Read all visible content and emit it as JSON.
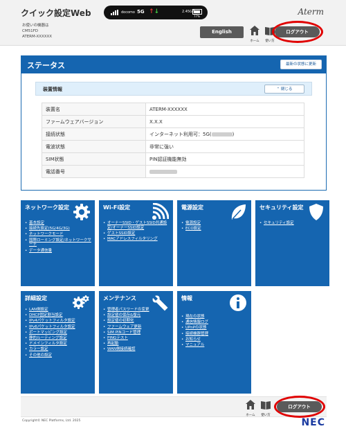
{
  "header": {
    "app_title": "クイック設定Web",
    "device_info": {
      "label": "お使いの機器は",
      "model": "CM51FD",
      "name": "ATERM-XXXXXX"
    },
    "statusbar": {
      "carrier": "docomo",
      "network": "5G",
      "data_used": "2.45GB",
      "battery": "77%"
    },
    "brand": "Aterm",
    "english_label": "English",
    "home_label": "ホーム",
    "usage_label": "使い方",
    "logout_label": "ログアウト"
  },
  "status": {
    "title": "ステータス",
    "refresh_label": "最新の状態に更新",
    "section_label": "装置情報",
    "close_label": "閉じる",
    "rows": [
      {
        "key": "装置名",
        "value": "ATERM-XXXXXX"
      },
      {
        "key": "ファームウェアバージョン",
        "value": "X.X.X"
      },
      {
        "key": "接続状態",
        "value": "インターネット利用可：5G(",
        "value_suffix": ")"
      },
      {
        "key": "電波状態",
        "value": "非常に強い"
      },
      {
        "key": "SIM状態",
        "value": "PIN認証機能無効"
      },
      {
        "key": "電話番号",
        "value": ""
      }
    ]
  },
  "tiles": [
    {
      "title": "ネットワーク設定",
      "icon": "gear-icon",
      "links": [
        "基本設定",
        "接続先設定(5G/4G/3G)",
        "ネットワークモード",
        "国際ローミング設定/ネットワークサーチ",
        "データ通信量"
      ]
    },
    {
      "title": "Wi-Fi設定",
      "icon": "wifi-icon",
      "links": [
        "オーナーSSID・ゲストSSID共通設定/オーナーSSID設定",
        "ゲストSSID設定",
        "MACアドレスフィルタリング"
      ]
    },
    {
      "title": "電源設定",
      "icon": "leaf-icon",
      "links": [
        "電源設定",
        "ECO設定"
      ]
    },
    {
      "title": "セキュリティ設定",
      "icon": "shield-icon",
      "links": [
        "セキュリティ設定"
      ]
    },
    {
      "title": "詳細設定",
      "icon": "gears-icon",
      "links": [
        "LAN側設定",
        "DHCP固定割当設定",
        "IPv4パケットフィルタ設定",
        "IPv6パケットフィルタ設定",
        "ポートマッピング設定",
        "静的ルーティング設定",
        "ドメインフィルタ設定",
        "カラー設定",
        "その他の設定"
      ]
    },
    {
      "title": "メンテナンス",
      "icon": "wrench-icon",
      "links": [
        "管理者パスワードの変更",
        "設定値の保存&復元",
        "設定値の初期化",
        "ファームウェア更新",
        "SIM PINコード管理",
        "PINGテスト",
        "再起動",
        "WAN側接続確認"
      ]
    },
    {
      "title": "情報",
      "icon": "info-icon",
      "links": [
        "現在の状態",
        "通信情報ログ",
        "UPnPの状態",
        "接続機器管理",
        "お知らせ",
        "マニュアル"
      ]
    }
  ],
  "footer": {
    "home_label": "ホーム",
    "usage_label": "使い方",
    "logout_label": "ログアウト",
    "copyright": "Copyright© NEC Platforms, Ltd. 2025",
    "nec_logo": "NEC"
  },
  "colors": {
    "tile_blue": "#1565b0",
    "highlight_red": "#e00000"
  }
}
